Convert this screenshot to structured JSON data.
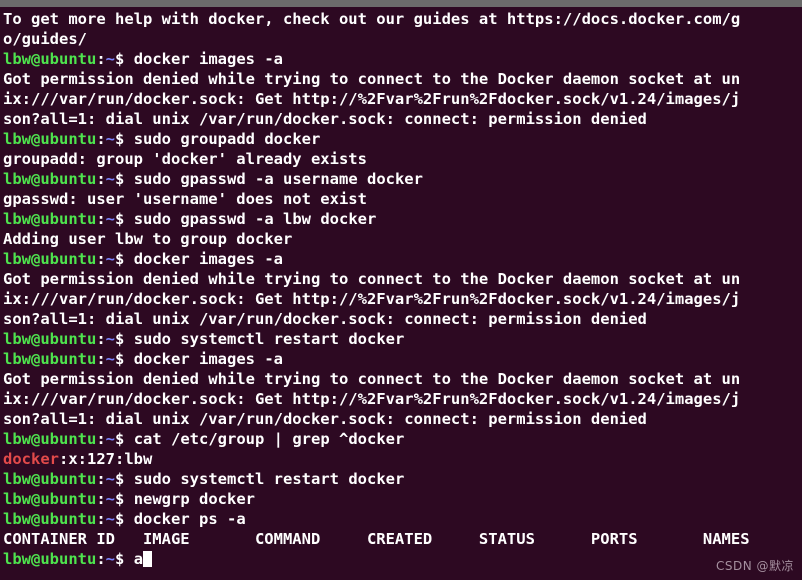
{
  "window": {
    "background_color": "#2d0922",
    "chrome_color": "#6b6b6b"
  },
  "colors": {
    "prompt_user_host": "#4ee44e",
    "prompt_path": "#7b84ff",
    "text": "#ffffff",
    "grep_match": "#e24a4a"
  },
  "prompt": {
    "user_host": "lbw@ubuntu",
    "colon": ":",
    "path": "~",
    "dollar": "$ "
  },
  "lines": [
    {
      "type": "output",
      "text": "To get more help with docker, check out our guides at https://docs.docker.com/g"
    },
    {
      "type": "output",
      "text": "o/guides/"
    },
    {
      "type": "command",
      "text": "docker images -a"
    },
    {
      "type": "output",
      "text": "Got permission denied while trying to connect to the Docker daemon socket at un"
    },
    {
      "type": "output",
      "text": "ix:///var/run/docker.sock: Get http://%2Fvar%2Frun%2Fdocker.sock/v1.24/images/j"
    },
    {
      "type": "output",
      "text": "son?all=1: dial unix /var/run/docker.sock: connect: permission denied"
    },
    {
      "type": "command",
      "text": "sudo groupadd docker"
    },
    {
      "type": "output",
      "text": "groupadd: group 'docker' already exists"
    },
    {
      "type": "command",
      "text": "sudo gpasswd -a username docker"
    },
    {
      "type": "output",
      "text": "gpasswd: user 'username' does not exist"
    },
    {
      "type": "command",
      "text": "sudo gpasswd -a lbw docker"
    },
    {
      "type": "output",
      "text": "Adding user lbw to group docker"
    },
    {
      "type": "command",
      "text": "docker images -a"
    },
    {
      "type": "output",
      "text": "Got permission denied while trying to connect to the Docker daemon socket at un"
    },
    {
      "type": "output",
      "text": "ix:///var/run/docker.sock: Get http://%2Fvar%2Frun%2Fdocker.sock/v1.24/images/j"
    },
    {
      "type": "output",
      "text": "son?all=1: dial unix /var/run/docker.sock: connect: permission denied"
    },
    {
      "type": "command",
      "text": "sudo systemctl restart docker"
    },
    {
      "type": "command",
      "text": "docker images -a"
    },
    {
      "type": "output",
      "text": "Got permission denied while trying to connect to the Docker daemon socket at un"
    },
    {
      "type": "output",
      "text": "ix:///var/run/docker.sock: Get http://%2Fvar%2Frun%2Fdocker.sock/v1.24/images/j"
    },
    {
      "type": "output",
      "text": "son?all=1: dial unix /var/run/docker.sock: connect: permission denied"
    },
    {
      "type": "command",
      "text": "cat /etc/group | grep ^docker"
    },
    {
      "type": "grep-result",
      "match": "docker",
      "rest": ":x:127:lbw"
    },
    {
      "type": "command",
      "text": "sudo systemctl restart docker"
    },
    {
      "type": "command",
      "text": "newgrp docker"
    },
    {
      "type": "command",
      "text": "docker ps -a"
    },
    {
      "type": "table-header",
      "text": "CONTAINER ID   IMAGE       COMMAND     CREATED     STATUS      PORTS       NAMES"
    },
    {
      "type": "current-command",
      "text": "a"
    }
  ],
  "docker_ps_table": {
    "headers": [
      "CONTAINER ID",
      "IMAGE",
      "COMMAND",
      "CREATED",
      "STATUS",
      "PORTS",
      "NAMES"
    ],
    "rows": []
  },
  "watermark": {
    "text": "CSDN @默凉"
  }
}
